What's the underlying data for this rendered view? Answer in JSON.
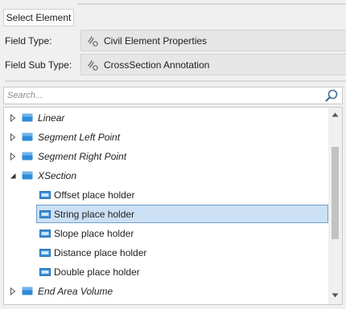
{
  "header": {
    "select_element_label": "Select Element"
  },
  "fields": {
    "field_type": {
      "label": "Field Type:",
      "value": "Civil Element Properties"
    },
    "field_sub_type": {
      "label": "Field Sub Type:",
      "value": "CrossSection Annotation"
    }
  },
  "search": {
    "placeholder": "Search...",
    "value": ""
  },
  "tree": {
    "items": [
      {
        "label": "Linear",
        "level": 0,
        "expanded": false,
        "selected": false
      },
      {
        "label": "Segment Left Point",
        "level": 0,
        "expanded": false,
        "selected": false
      },
      {
        "label": "Segment Right Point",
        "level": 0,
        "expanded": false,
        "selected": false
      },
      {
        "label": "XSection",
        "level": 0,
        "expanded": true,
        "selected": false
      },
      {
        "label": "Offset place holder",
        "level": 1,
        "selected": false
      },
      {
        "label": "String place holder",
        "level": 1,
        "selected": true
      },
      {
        "label": "Slope place holder",
        "level": 1,
        "selected": false
      },
      {
        "label": "Distance place holder",
        "level": 1,
        "selected": false
      },
      {
        "label": "Double place holder",
        "level": 1,
        "selected": false
      },
      {
        "label": "End Area Volume",
        "level": 0,
        "expanded": false,
        "selected": false
      }
    ]
  },
  "icons": {
    "field_icon": "link-gear-icon",
    "node_icon": "folder-node-icon",
    "leaf_icon": "text-field-icon",
    "search_icon": "magnifier-icon"
  },
  "colors": {
    "selection_bg": "#cce0f5",
    "selection_border": "#6e9fd0",
    "node_icon_blue": "#2f8bd8",
    "leaf_icon_blue": "#3b8fd9"
  }
}
